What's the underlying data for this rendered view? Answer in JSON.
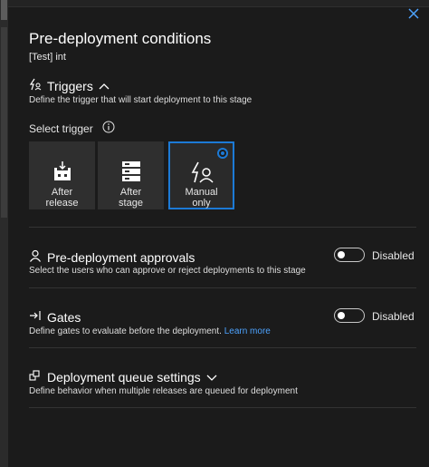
{
  "panel": {
    "title": "Pre-deployment conditions",
    "subtitle": "[Test] int",
    "close_icon": "close-icon"
  },
  "triggers": {
    "title": "Triggers",
    "description": "Define the trigger that will start deployment to this stage",
    "select_label": "Select trigger",
    "options": [
      {
        "label": "After\nrelease",
        "icon": "after-release-icon",
        "selected": false
      },
      {
        "label": "After\nstage",
        "icon": "after-stage-icon",
        "selected": false
      },
      {
        "label": "Manual\nonly",
        "icon": "manual-only-icon",
        "selected": true
      }
    ]
  },
  "approvals": {
    "title": "Pre-deployment approvals",
    "description": "Select the users who can approve or reject deployments to this stage",
    "toggle_label": "Disabled"
  },
  "gates": {
    "title": "Gates",
    "description": "Define gates to evaluate before the deployment.",
    "learn_more": "Learn more",
    "toggle_label": "Disabled"
  },
  "queue": {
    "title": "Deployment queue settings",
    "description": "Define behavior when multiple releases are queued for deployment"
  },
  "colors": {
    "accent": "#1c7ad6",
    "link": "#4da3ff",
    "background": "#1b1b1b",
    "tile": "#2f2f2f"
  }
}
